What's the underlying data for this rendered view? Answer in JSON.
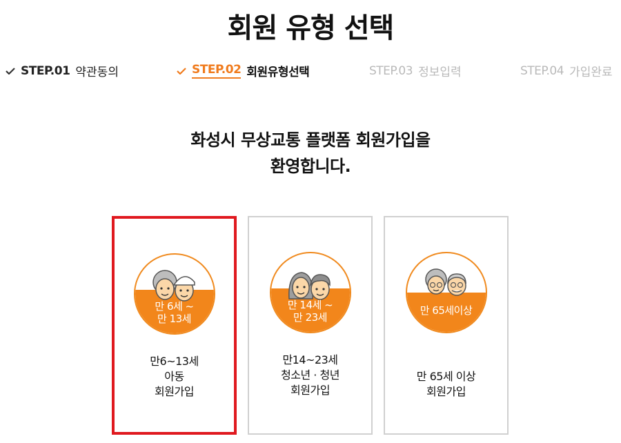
{
  "page": {
    "title": "회원 유형 선택"
  },
  "steps": [
    {
      "num": "STEP.01",
      "name": "약관동의",
      "state": "done"
    },
    {
      "num": "STEP.02",
      "name": "회원유형선택",
      "state": "active"
    },
    {
      "num": "STEP.03",
      "name": "정보입력",
      "state": "pending"
    },
    {
      "num": "STEP.04",
      "name": "가입완료",
      "state": "pending"
    }
  ],
  "welcome": {
    "line1": "화성시 무상교통 플랫폼 회원가입을",
    "line2": "환영합니다."
  },
  "cards": [
    {
      "badge_line1": "만 6세 ~",
      "badge_line2": "만 13세",
      "label_line1": "만6~13세",
      "label_line2": "아동",
      "label_line3": "회원가입",
      "icon": "children-icon",
      "selected": true
    },
    {
      "badge_line1": "만 14세 ~",
      "badge_line2": "만 23세",
      "label_line1": "만14~23세",
      "label_line2": "청소년 · 청년",
      "label_line3": "회원가입",
      "icon": "youth-icon",
      "selected": false
    },
    {
      "badge_line1": "만 65세이상",
      "badge_line2": "",
      "label_line1": "만 65세 이상",
      "label_line2": "회원가입",
      "label_line3": "",
      "icon": "seniors-icon",
      "selected": false
    }
  ],
  "colors": {
    "accent": "#f07b1d",
    "selected_border": "#e0191f",
    "inactive_step": "#b9b9b9"
  }
}
